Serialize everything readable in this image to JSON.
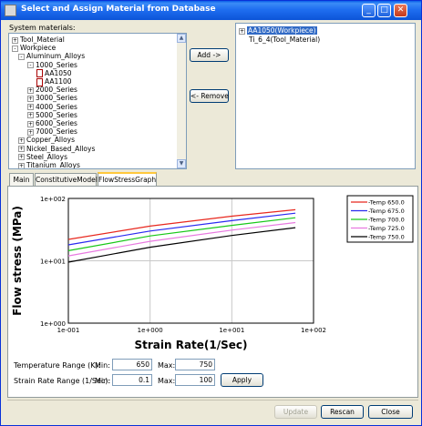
{
  "window": {
    "title": "Select and Assign Material from Database"
  },
  "system_materials_label": "System materials:",
  "tree": [
    {
      "label": "Tool_Material",
      "expander": "+"
    },
    {
      "label": "Workpiece",
      "expander": "-"
    },
    {
      "label": "Aluminum_Alloys",
      "expander": "-"
    },
    {
      "label": "1000_Series",
      "expander": "-"
    },
    {
      "label": "AA1050",
      "expander": ""
    },
    {
      "label": "AA1100",
      "expander": ""
    },
    {
      "label": "2000_Series",
      "expander": "+"
    },
    {
      "label": "3000_Series",
      "expander": "+"
    },
    {
      "label": "4000_Series",
      "expander": "+"
    },
    {
      "label": "5000_Series",
      "expander": "+"
    },
    {
      "label": "6000_Series",
      "expander": "+"
    },
    {
      "label": "7000_Series",
      "expander": "+"
    },
    {
      "label": "Copper_Alloys",
      "expander": "+"
    },
    {
      "label": "Nickel_Based_Alloys",
      "expander": "+"
    },
    {
      "label": "Steel_Alloys",
      "expander": "+"
    },
    {
      "label": "Titanium_Alloys",
      "expander": "+"
    }
  ],
  "buttons": {
    "add": "Add ->",
    "remove": "<- Remove",
    "apply": "Apply",
    "update": "Update",
    "rescan": "Rescan",
    "close": "Close"
  },
  "assigned": [
    {
      "label": "AA1050(Workpiece)",
      "expander": "+",
      "selected": true
    },
    {
      "label": "Ti_6_4(Tool_Material)",
      "expander": "",
      "selected": false
    }
  ],
  "tabs": [
    "Main",
    "ConstitutiveModel",
    "FlowStressGraph"
  ],
  "active_tab": "FlowStressGraph",
  "controls": {
    "temp_range_label": "Temperature Range (K):",
    "strain_rate_label": "Strain Rate Range (1/Sec):",
    "min_label": "Min:",
    "max_label": "Max:",
    "temp_min": "650",
    "temp_max": "750",
    "sr_min": "0.1",
    "sr_max": "100"
  },
  "chart_data": {
    "type": "line",
    "xlabel": "Strain Rate(1/Sec)",
    "ylabel": "Flow stress (MPa)",
    "xscale": "log",
    "yscale": "log",
    "xlim": [
      0.1,
      100
    ],
    "ylim": [
      1,
      100
    ],
    "xticks": [
      "1e-001",
      "1e+000",
      "1e+001",
      "1e+002"
    ],
    "yticks": [
      "1e+000",
      "1e+001",
      "1e+002"
    ],
    "grid": true,
    "legend_position": "right",
    "x": [
      0.1,
      1,
      10,
      60
    ],
    "series": [
      {
        "name": "-Temp 650.0",
        "color": "#e8281e",
        "values": [
          22,
          36,
          52,
          66
        ]
      },
      {
        "name": "-Temp 675.0",
        "color": "#2a2af0",
        "values": [
          18,
          30,
          44,
          58
        ]
      },
      {
        "name": "-Temp 700.0",
        "color": "#18c818",
        "values": [
          14.5,
          25,
          37,
          49
        ]
      },
      {
        "name": "-Temp 725.0",
        "color": "#e87ae0",
        "values": [
          12,
          20.5,
          31,
          41
        ]
      },
      {
        "name": "-Temp 750.0",
        "color": "#000000",
        "values": [
          9.5,
          16.5,
          25.5,
          34
        ]
      }
    ]
  }
}
